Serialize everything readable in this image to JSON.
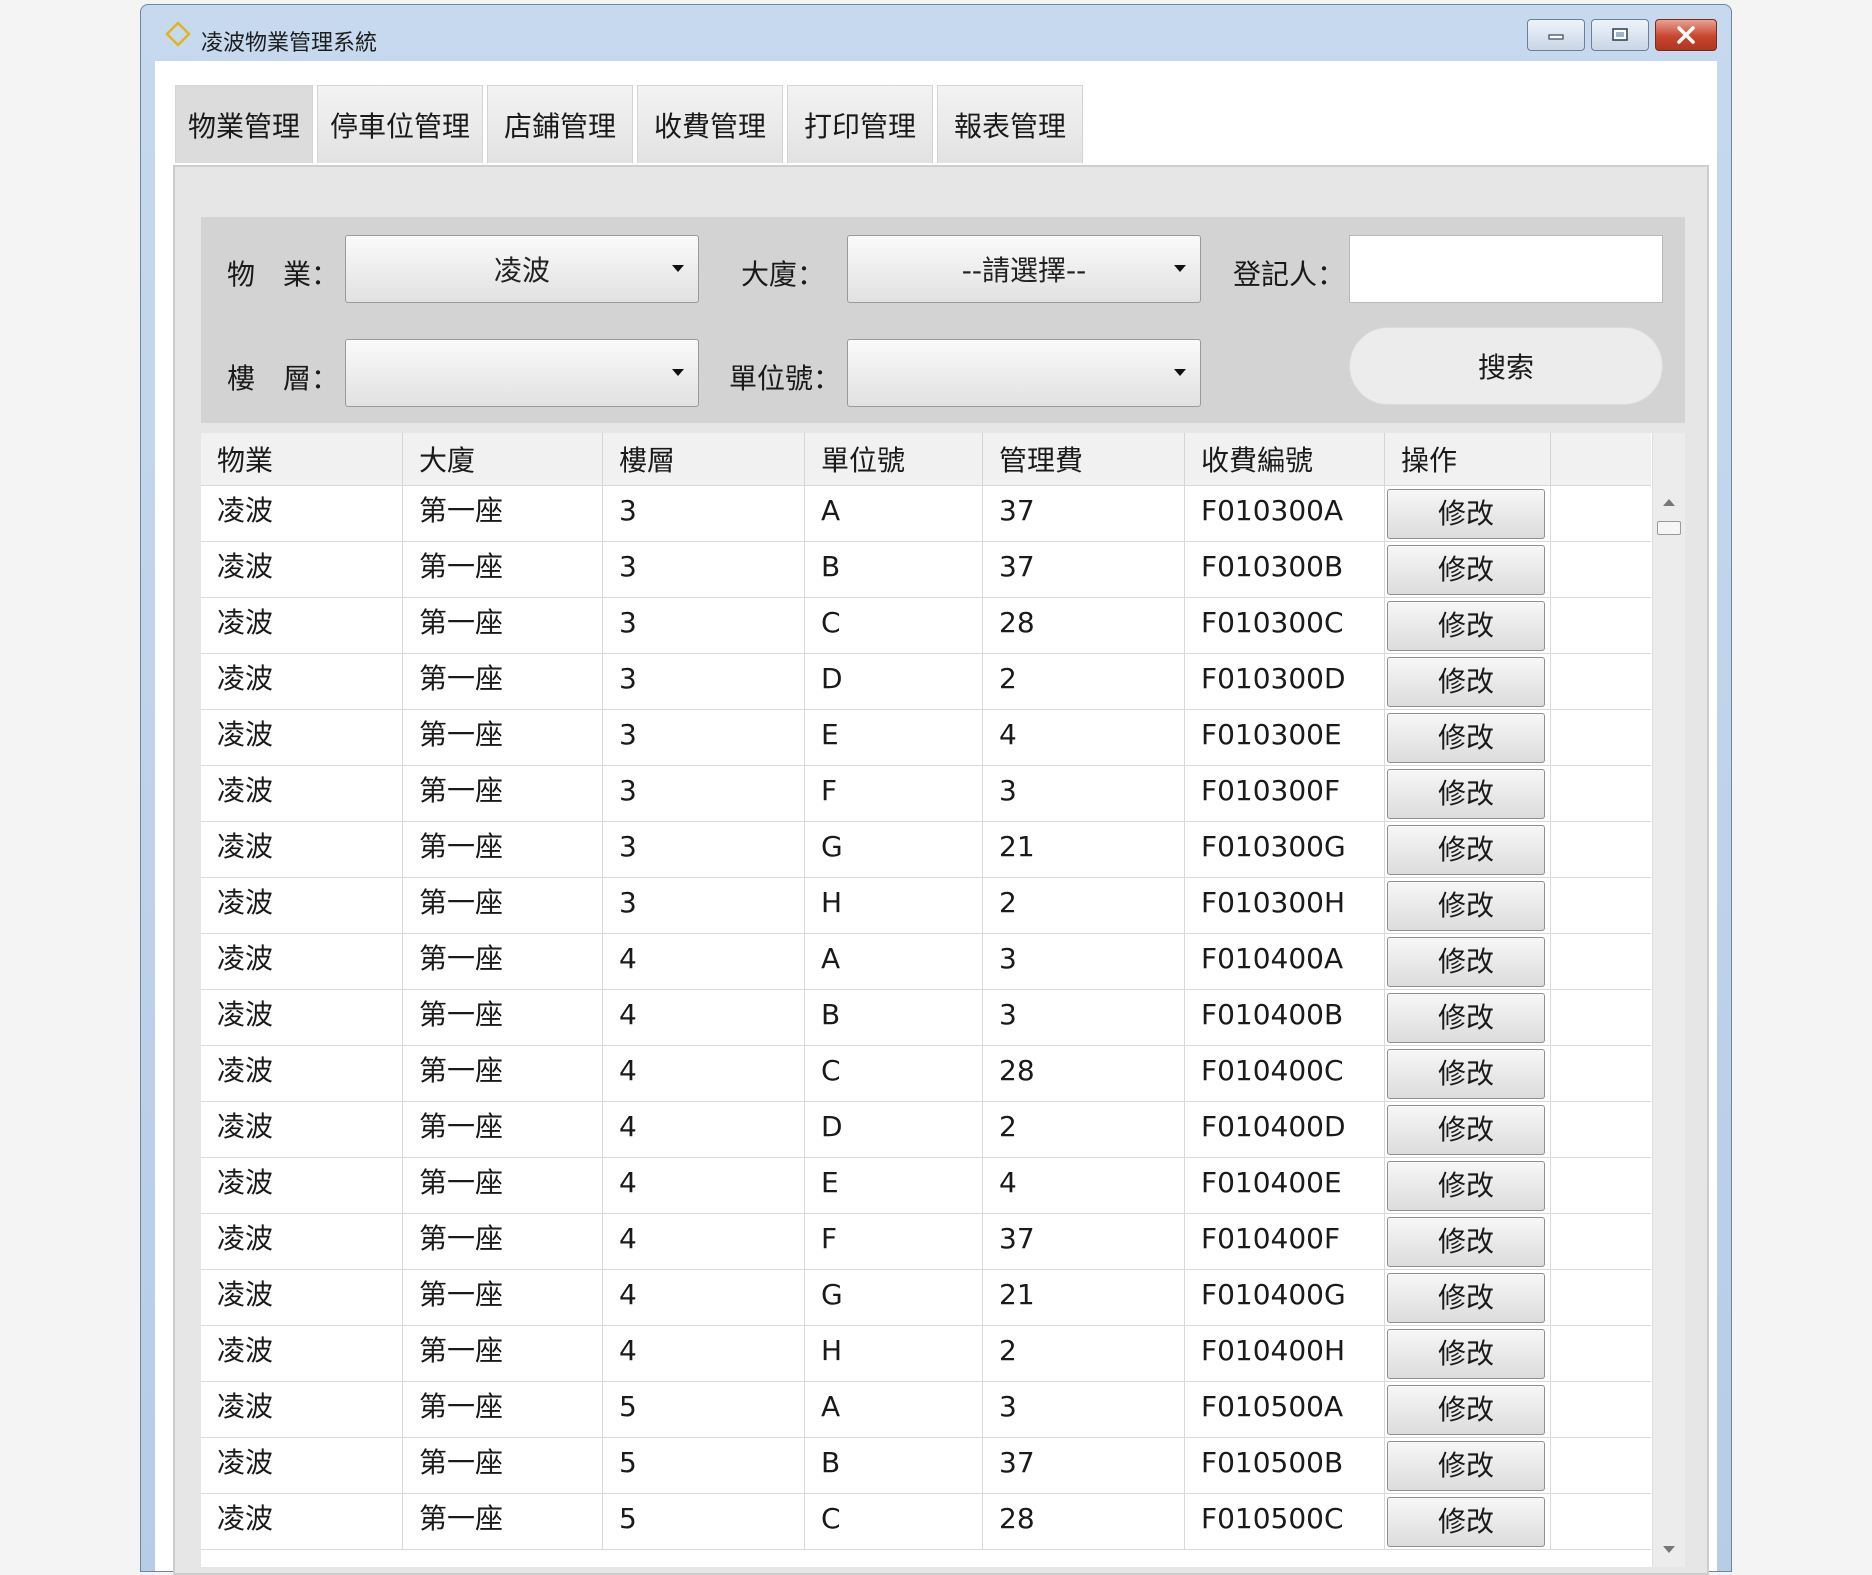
{
  "window": {
    "title": "凌波物業管理系統"
  },
  "tabs": [
    {
      "label": "物業管理",
      "active": true
    },
    {
      "label": "停車位管理",
      "active": false
    },
    {
      "label": "店鋪管理",
      "active": false
    },
    {
      "label": "收費管理",
      "active": false
    },
    {
      "label": "打印管理",
      "active": false
    },
    {
      "label": "報表管理",
      "active": false
    }
  ],
  "search": {
    "property_label": "物　業：",
    "property_value": "凌波",
    "building_label": "大廈：",
    "building_value": "--請選擇--",
    "registrar_label": "登記人：",
    "registrar_value": "",
    "floor_label": "樓　層：",
    "floor_value": "",
    "unit_label": "單位號：",
    "unit_value": "",
    "search_button": "搜索"
  },
  "table": {
    "columns": [
      "物業",
      "大廈",
      "樓層",
      "單位號",
      "管理費",
      "收費編號",
      "操作"
    ],
    "action_label": "修改",
    "rows": [
      [
        "凌波",
        "第一座",
        "3",
        "A",
        "37",
        "F010300A"
      ],
      [
        "凌波",
        "第一座",
        "3",
        "B",
        "37",
        "F010300B"
      ],
      [
        "凌波",
        "第一座",
        "3",
        "C",
        "28",
        "F010300C"
      ],
      [
        "凌波",
        "第一座",
        "3",
        "D",
        "2",
        "F010300D"
      ],
      [
        "凌波",
        "第一座",
        "3",
        "E",
        "4",
        "F010300E"
      ],
      [
        "凌波",
        "第一座",
        "3",
        "F",
        "3",
        "F010300F"
      ],
      [
        "凌波",
        "第一座",
        "3",
        "G",
        "21",
        "F010300G"
      ],
      [
        "凌波",
        "第一座",
        "3",
        "H",
        "2",
        "F010300H"
      ],
      [
        "凌波",
        "第一座",
        "4",
        "A",
        "3",
        "F010400A"
      ],
      [
        "凌波",
        "第一座",
        "4",
        "B",
        "3",
        "F010400B"
      ],
      [
        "凌波",
        "第一座",
        "4",
        "C",
        "28",
        "F010400C"
      ],
      [
        "凌波",
        "第一座",
        "4",
        "D",
        "2",
        "F010400D"
      ],
      [
        "凌波",
        "第一座",
        "4",
        "E",
        "4",
        "F010400E"
      ],
      [
        "凌波",
        "第一座",
        "4",
        "F",
        "37",
        "F010400F"
      ],
      [
        "凌波",
        "第一座",
        "4",
        "G",
        "21",
        "F010400G"
      ],
      [
        "凌波",
        "第一座",
        "4",
        "H",
        "2",
        "F010400H"
      ],
      [
        "凌波",
        "第一座",
        "5",
        "A",
        "3",
        "F010500A"
      ],
      [
        "凌波",
        "第一座",
        "5",
        "B",
        "37",
        "F010500B"
      ],
      [
        "凌波",
        "第一座",
        "5",
        "C",
        "28",
        "F010500C"
      ]
    ]
  }
}
